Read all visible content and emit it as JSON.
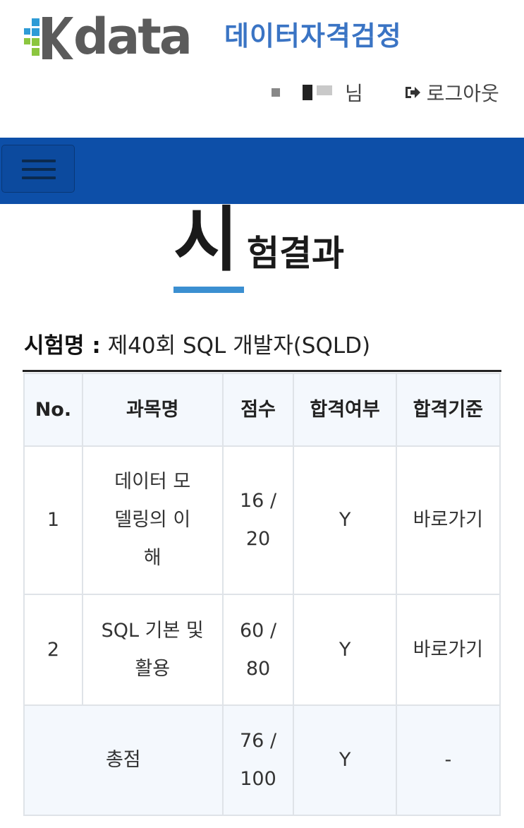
{
  "header": {
    "logo_word": "data",
    "logo_sub": "데이터자격검정",
    "user_suffix": "님",
    "logout_label": "로그아웃"
  },
  "colors": {
    "nav_bg": "#0d4fa8",
    "logo_sub": "#3a74c4",
    "title_underline": "#3b8fd1",
    "table_header_bg": "#f4f8fd"
  },
  "nav": {
    "menu_icon": "hamburger-menu-icon"
  },
  "page": {
    "title_first_char": "시",
    "title_rest": "험결과"
  },
  "exam": {
    "label": "시험명 :",
    "name": "제40회 SQL 개발자(SQLD)"
  },
  "table": {
    "headers": [
      "No.",
      "과목명",
      "점수",
      "합격여부",
      "합격기준"
    ],
    "rows": [
      {
        "no": "1",
        "subject": "데이터 모델링의 이해",
        "score": "16 / 20",
        "pass": "Y",
        "criteria": "바로가기"
      },
      {
        "no": "2",
        "subject": "SQL 기본 및 활용",
        "score": "60 / 80",
        "pass": "Y",
        "criteria": "바로가기"
      }
    ],
    "total": {
      "label": "총점",
      "score": "76 / 100",
      "pass": "Y",
      "criteria": "-"
    }
  }
}
